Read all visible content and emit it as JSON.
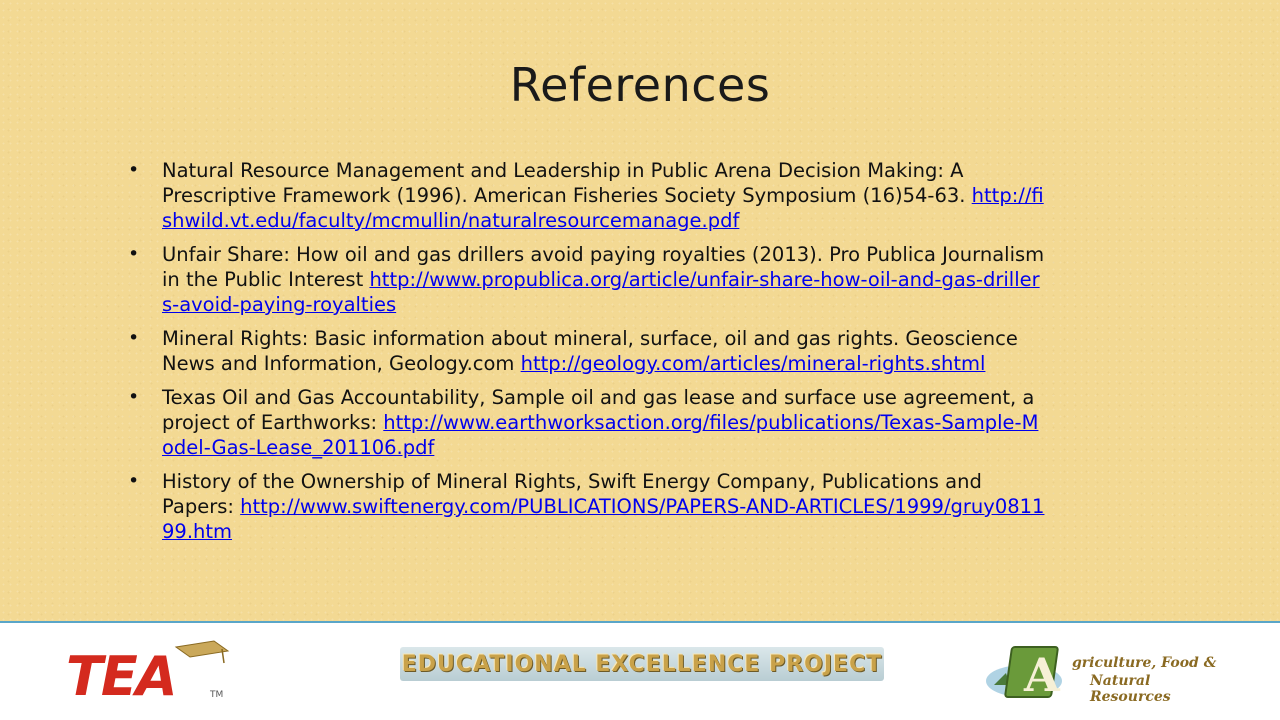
{
  "slide": {
    "title": "References"
  },
  "references": [
    {
      "text": "Natural Resource Management and Leadership in Public Arena Decision Making: A Prescriptive Framework (1996).  American Fisheries Society Symposium (16)54-63. ",
      "link": "http://fishwild.vt.edu/faculty/mcmullin/naturalresourcemanage.pdf"
    },
    {
      "text": "Unfair Share:  How oil and gas drillers avoid paying royalties (2013).  Pro Publica Journalism in the Public Interest ",
      "link": "http://www.propublica.org/article/unfair-share-how-oil-and-gas-drillers-avoid-paying-royalties"
    },
    {
      "text": "Mineral Rights:  Basic information about mineral, surface, oil and gas rights.  Geoscience News and Information, Geology.com ",
      "link": "http://geology.com/articles/mineral-rights.shtml"
    },
    {
      "text": "Texas Oil and Gas Accountability, Sample oil and gas lease and surface use agreement, a project of Earthworks: ",
      "link": "http://www.earthworksaction.org/files/publications/Texas-Sample-Model-Gas-Lease_201106.pdf"
    },
    {
      "text": "History of the Ownership of Mineral Rights, Swift Energy Company, Publications and Papers:  ",
      "link": "http://www.swiftenergy.com/PUBLICATIONS/PAPERS-AND-ARTICLES/1999/gruy081199.htm"
    }
  ],
  "footer": {
    "tea_logo": "TEA",
    "tea_tm": "TM",
    "banner": "EDUCATIONAL EXCELLENCE PROJECT",
    "afnr_line1": "griculture, Food &",
    "afnr_line2": "Natural Resources",
    "afnr_letter": "A"
  },
  "colors": {
    "background": "#f3d993",
    "link": "#0000ee",
    "tea_red": "#d42a1e",
    "footer_border": "#5aa6c8"
  }
}
